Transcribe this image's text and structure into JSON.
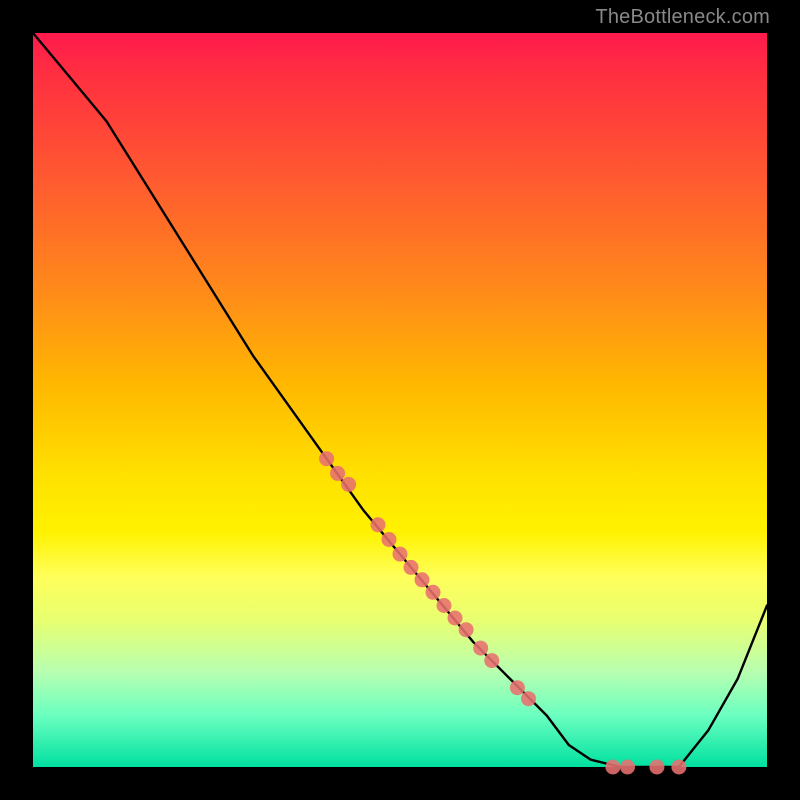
{
  "watermark": "TheBottleneck.com",
  "colors": {
    "dot": "#e87070",
    "curve": "#000000"
  },
  "chart_data": {
    "type": "line",
    "title": "",
    "xlabel": "",
    "ylabel": "",
    "xlim": [
      0,
      100
    ],
    "ylim": [
      0,
      100
    ],
    "grid": false,
    "series": [
      {
        "name": "curve",
        "x": [
          0,
          5,
          10,
          15,
          20,
          25,
          30,
          35,
          40,
          45,
          50,
          55,
          60,
          65,
          70,
          73,
          76,
          80,
          84,
          88,
          92,
          96,
          100
        ],
        "y": [
          100,
          94,
          88,
          80,
          72,
          64,
          56,
          49,
          42,
          35,
          29,
          23,
          17,
          12,
          7,
          3,
          1,
          0,
          0,
          0,
          5,
          12,
          22
        ]
      }
    ],
    "points": [
      {
        "x": 40,
        "y": 42
      },
      {
        "x": 41.5,
        "y": 40
      },
      {
        "x": 43,
        "y": 38.5
      },
      {
        "x": 47,
        "y": 33
      },
      {
        "x": 48.5,
        "y": 31
      },
      {
        "x": 50,
        "y": 29
      },
      {
        "x": 51.5,
        "y": 27.2
      },
      {
        "x": 53,
        "y": 25.5
      },
      {
        "x": 54.5,
        "y": 23.8
      },
      {
        "x": 56,
        "y": 22
      },
      {
        "x": 57.5,
        "y": 20.3
      },
      {
        "x": 59,
        "y": 18.7
      },
      {
        "x": 61,
        "y": 16.2
      },
      {
        "x": 62.5,
        "y": 14.5
      },
      {
        "x": 66,
        "y": 10.8
      },
      {
        "x": 67.5,
        "y": 9.3
      },
      {
        "x": 79,
        "y": 0
      },
      {
        "x": 81,
        "y": 0
      },
      {
        "x": 85,
        "y": 0
      },
      {
        "x": 88,
        "y": 0
      }
    ]
  }
}
